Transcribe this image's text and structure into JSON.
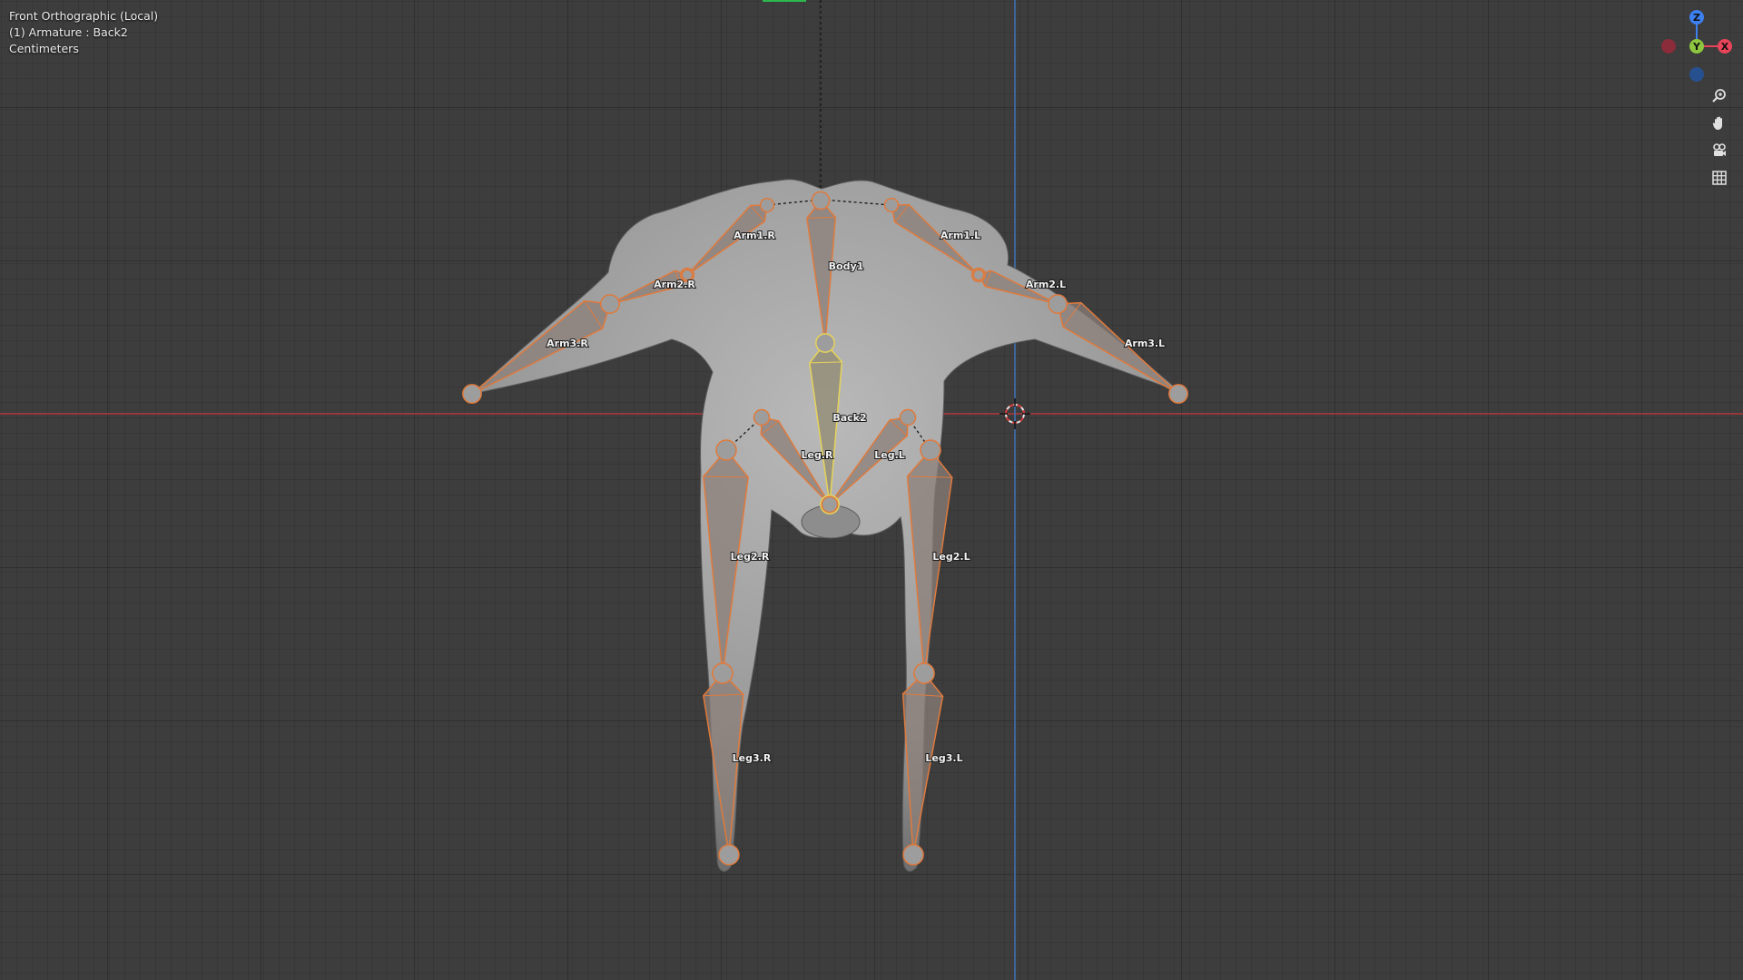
{
  "viewport": {
    "info_lines": [
      "Front Orthographic (Local)",
      "(1) Armature : Back2",
      "Centimeters"
    ],
    "colors": {
      "background": "#3d3d3d",
      "x_axis": "#c0393b",
      "z_axis": "#3a78c4",
      "bone_outline": "#e07a3c",
      "bone_fill": "#8b7f7a",
      "active_bone": "#e6d35a",
      "mesh": "#a9a9a9"
    }
  },
  "gizmo": {
    "axes": [
      {
        "label": "Z",
        "color": "#3c7ff0"
      },
      {
        "label": "Y",
        "color": "#8ec63f"
      },
      {
        "label": "X",
        "color": "#e8445a"
      }
    ]
  },
  "nav_tools": [
    "zoom-icon",
    "hand-pan-icon",
    "camera-view-icon",
    "grid-ortho-icon"
  ],
  "armature": {
    "bones": [
      {
        "name": "Arm1.R"
      },
      {
        "name": "Arm2.R"
      },
      {
        "name": "Arm3.R"
      },
      {
        "name": "Arm1.L"
      },
      {
        "name": "Arm2.L"
      },
      {
        "name": "Arm3.L"
      },
      {
        "name": "Body1"
      },
      {
        "name": "Back2"
      },
      {
        "name": "Leg.R"
      },
      {
        "name": "Leg.L"
      },
      {
        "name": "Leg2.R"
      },
      {
        "name": "Leg2.L"
      },
      {
        "name": "Leg3.R"
      },
      {
        "name": "Leg3.L"
      }
    ]
  }
}
